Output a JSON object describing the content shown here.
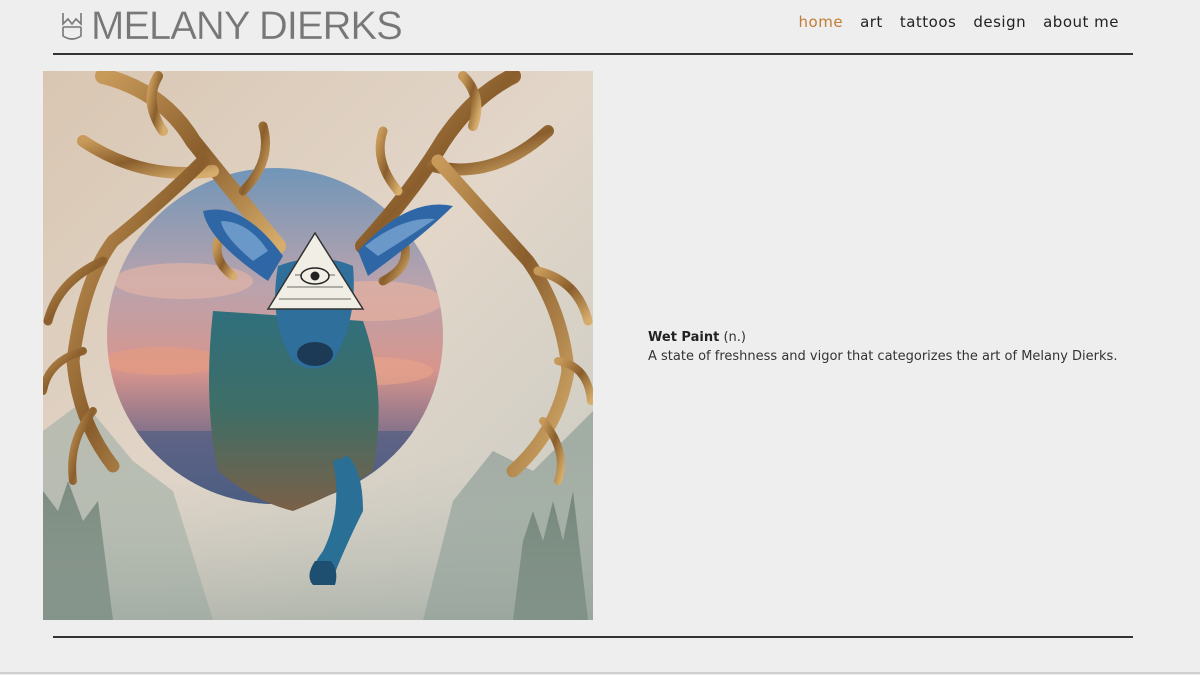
{
  "header": {
    "logo_text": "MELANY DIERKS",
    "logo_mark_icon": "md-monogram-icon"
  },
  "nav": {
    "items": [
      {
        "label": "home",
        "active": true
      },
      {
        "label": "art",
        "active": false
      },
      {
        "label": "tattoos",
        "active": false
      },
      {
        "label": "design",
        "active": false
      },
      {
        "label": "about me",
        "active": false
      }
    ]
  },
  "artwork": {
    "subject": "painting of a blue deer with antlers and an all-seeing-eye pyramid over a sunset circle"
  },
  "definition": {
    "term": "Wet Paint",
    "part_of_speech": " (n.)",
    "text": "A state of freshness and vigor that categorizes the art of Melany Dierks."
  },
  "colors": {
    "background": "#eeeeee",
    "accent": "#c27c35",
    "text": "#222222",
    "rule": "#333333"
  }
}
